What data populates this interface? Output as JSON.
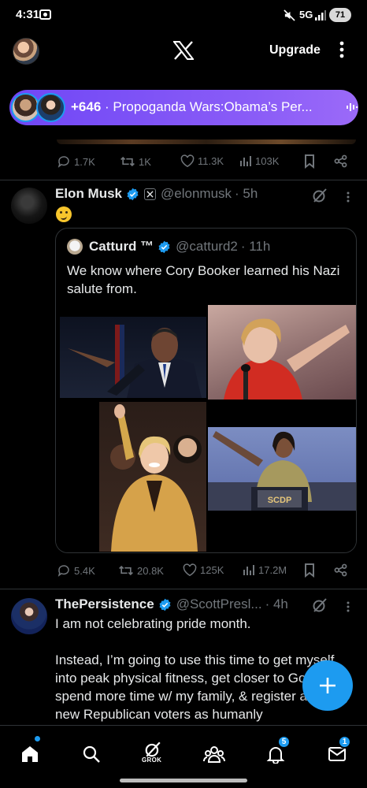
{
  "status_bar": {
    "time": "4:31",
    "network": "5G",
    "battery": "71"
  },
  "top_bar": {
    "upgrade_label": "Upgrade"
  },
  "space_pill": {
    "count": "+646",
    "title": "· Propoganda Wars:Obama’s Per..."
  },
  "previous_post": {
    "replies": "1.7K",
    "reposts": "1K",
    "likes": "11.3K",
    "views": "103K"
  },
  "tweets": [
    {
      "name": "Elon Musk",
      "handle": "@elonmusk",
      "time": "· 5h",
      "quote": {
        "name": "Catturd ™",
        "handle": "@catturd2",
        "time": "· 11h",
        "text": "We know where Cory Booker learned his Nazi salute from."
      },
      "stats": {
        "replies": "5.4K",
        "reposts": "20.8K",
        "likes": "125K",
        "views": "17.2M"
      }
    },
    {
      "name": "ThePersistence",
      "handle": "@ScottPresl...",
      "time": "· 4h",
      "text_line1": "I am not celebrating pride month.",
      "text_line2": "Instead, I’m going to use this time to get myself into peak physical fitness, get closer to God, spend more time w/ my family, & register as many new Republican voters as humanly"
    }
  ],
  "podium_sign": "SCDP",
  "bottom_nav": {
    "grok_label": "GROK",
    "notifications_badge": "5",
    "messages_badge": "1"
  },
  "colors": {
    "accent": "#1d9bf0",
    "pill_start": "#7047f5",
    "pill_end": "#9b6af8",
    "muted": "#71767b"
  }
}
